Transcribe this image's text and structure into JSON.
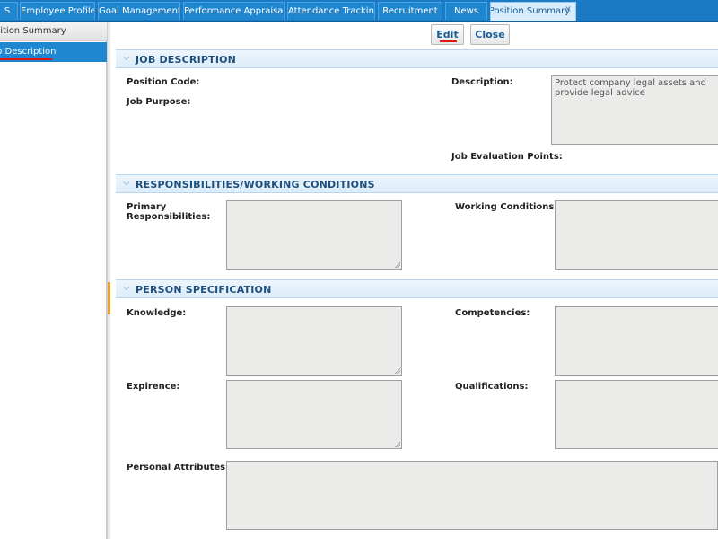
{
  "tabs": [
    {
      "label": "S"
    },
    {
      "label": "Employee Profile"
    },
    {
      "label": "Goal Management"
    },
    {
      "label": "Performance Appraisals"
    },
    {
      "label": "Attendance Tracking"
    },
    {
      "label": "Recruitment"
    },
    {
      "label": "News"
    },
    {
      "label": "Position Summary",
      "close": "×"
    }
  ],
  "sidebar": {
    "items": [
      {
        "label": "sition Summary"
      },
      {
        "label": "b Description"
      }
    ]
  },
  "toolbar": {
    "edit_label": "Edit",
    "close_label": "Close"
  },
  "sections": {
    "job_description": {
      "title": "JOB DESCRIPTION",
      "position_code_label": "Position Code:",
      "job_purpose_label": "Job Purpose:",
      "description_label": "Description:",
      "description_value": "Protect company legal assets and provide legal advice",
      "evaluation_points_label": "Job Evaluation Points:"
    },
    "responsibilities": {
      "title": "RESPONSIBILITIES/WORKING CONDITIONS",
      "primary_label_line1": "Primary",
      "primary_label_line2": "Responsibilities:",
      "working_conditions_label": "Working Conditions:"
    },
    "person_spec": {
      "title": "PERSON SPECIFICATION",
      "knowledge_label": "Knowledge:",
      "competencies_label": "Competencies:",
      "experience_label": "Expirence:",
      "qualifications_label": "Qualifications:",
      "personal_attributes_label": "Personal Attributes:"
    }
  },
  "colors": {
    "accent": "#1f86d0",
    "header_text": "#1f4f7c",
    "highlight": "#e01616"
  }
}
